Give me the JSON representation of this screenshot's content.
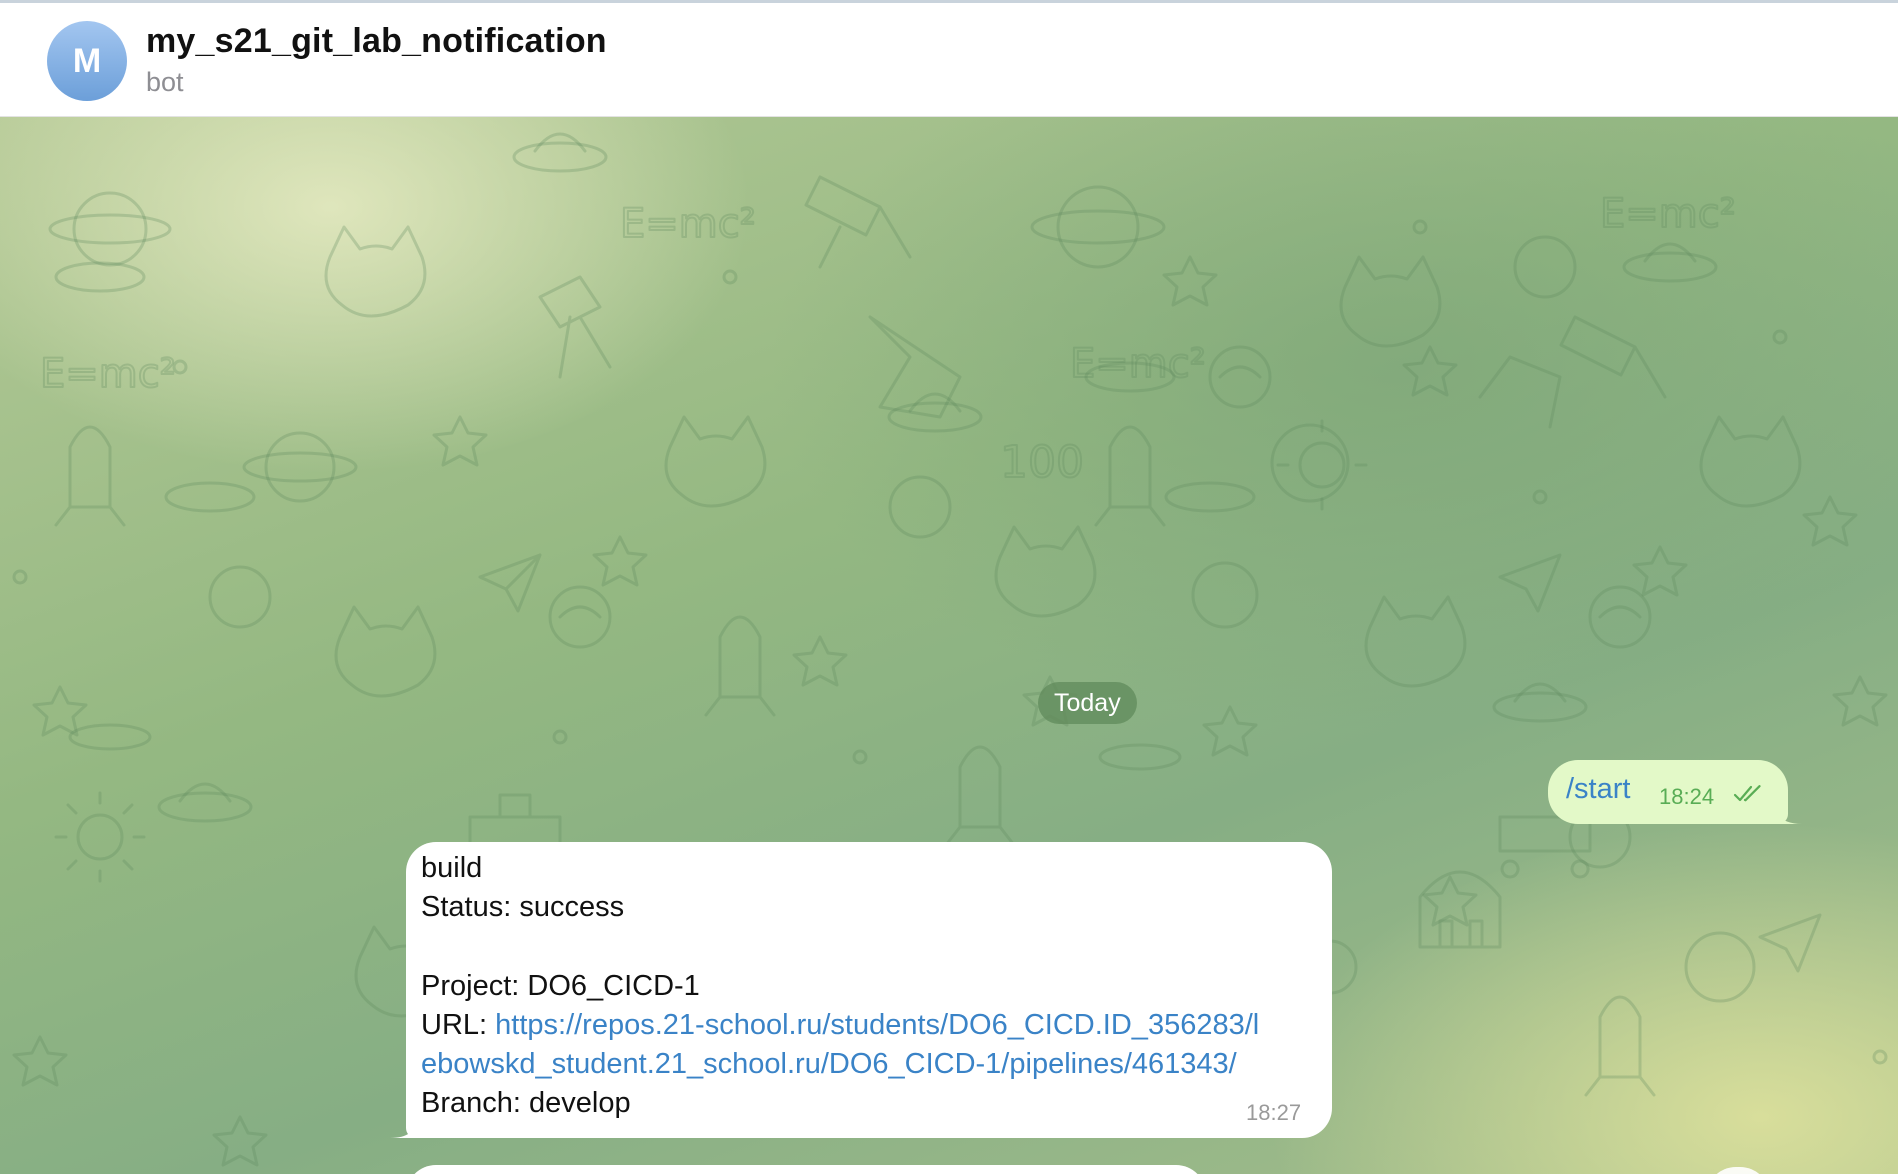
{
  "header": {
    "avatar_letter": "M",
    "title": "my_s21_git_lab_notification",
    "subtitle": "bot"
  },
  "chat": {
    "date_separator": "Today",
    "outgoing": {
      "text": "/start",
      "time": "18:24",
      "status": "read-double-check-icon"
    },
    "incoming": {
      "line1": "build",
      "line2": "Status: success",
      "line3": "Project: DO6_CICD-1",
      "url_label": "URL: ",
      "url_part1": "https://repos.21-school.ru/students/DO6_CICD.ID_356283/l",
      "url_part2": "ebowskd_student.21_school.ru/DO6_CICD-1/pipelines/461343/",
      "line5": "Branch: develop",
      "time": "18:27"
    }
  },
  "colors": {
    "accent": "#3a83c7",
    "outgoing_bubble": "#e3f9c8",
    "outgoing_time": "#59ad55",
    "incoming_bubble": "#ffffff",
    "avatar_top": "#a3c6f0",
    "avatar_bottom": "#6c9fd9"
  }
}
